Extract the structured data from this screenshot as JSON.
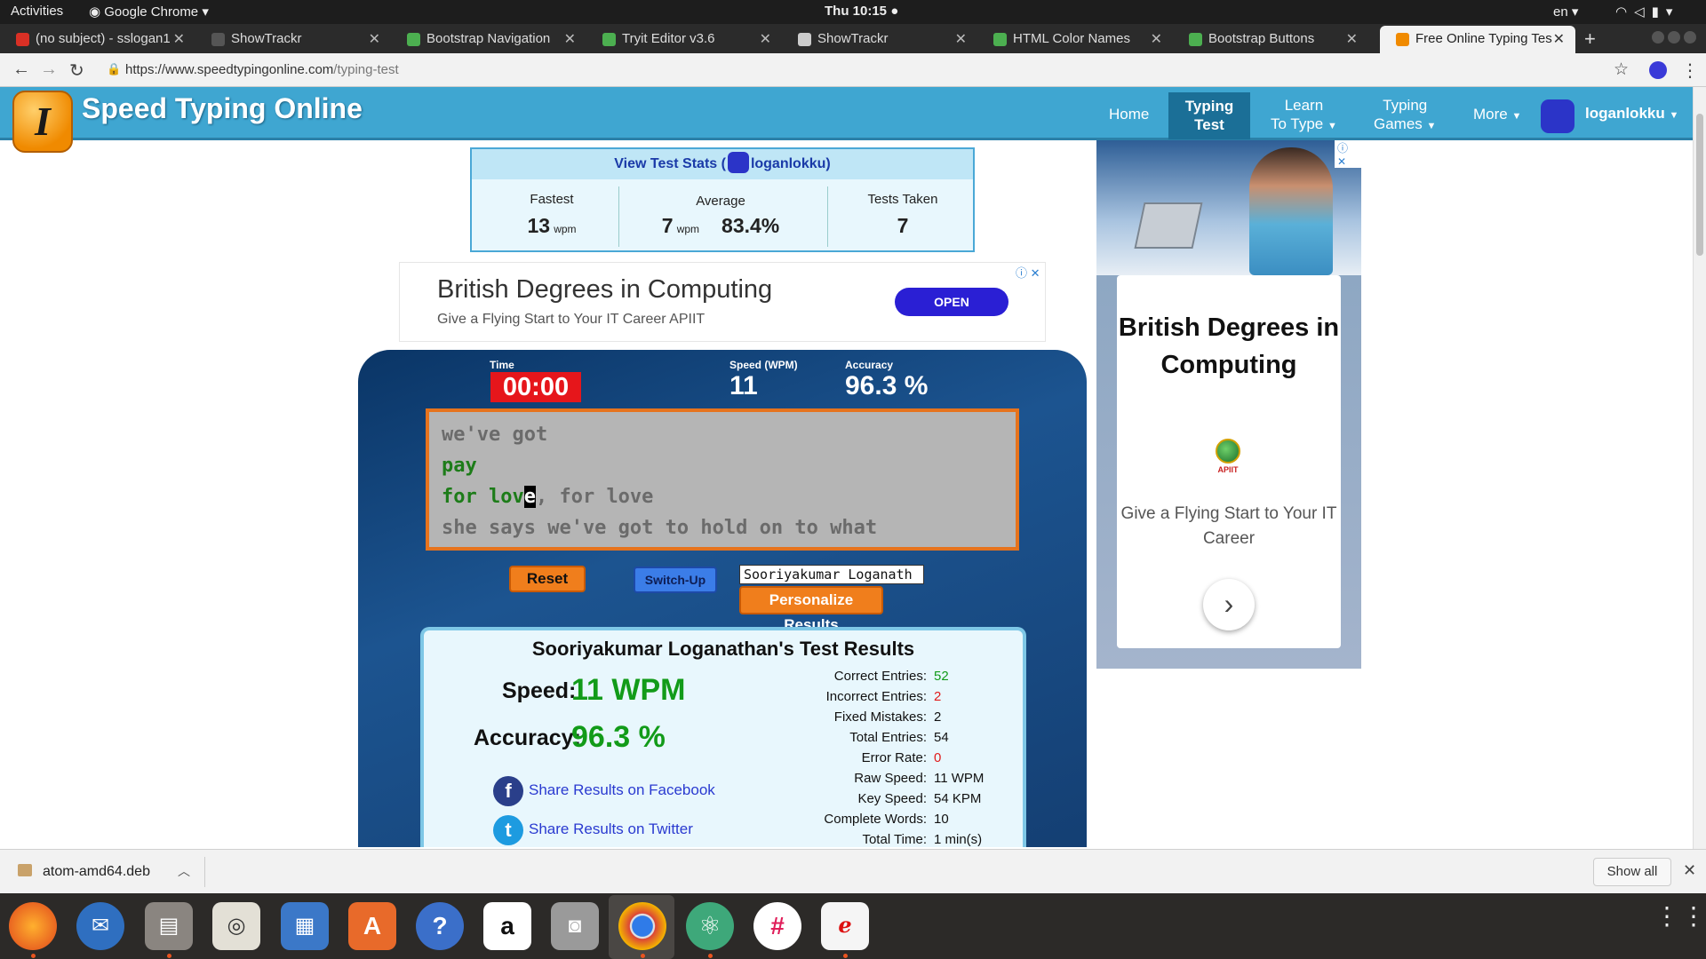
{
  "os": {
    "activities": "Activities",
    "app_menu": "Google Chrome",
    "clock": "Thu 10:15",
    "lang": "en"
  },
  "browser": {
    "tabs": [
      {
        "label": "(no subject) - sslogan1",
        "favicon_color": "#d93025"
      },
      {
        "label": "ShowTrackr",
        "favicon_color": "#555555"
      },
      {
        "label": "Bootstrap Navigation",
        "favicon_color": "#4caf50"
      },
      {
        "label": "Tryit Editor v3.6",
        "favicon_color": "#4caf50"
      },
      {
        "label": "ShowTrackr",
        "favicon_color": "#cccccc"
      },
      {
        "label": "HTML Color Names",
        "favicon_color": "#4caf50"
      },
      {
        "label": "Bootstrap Buttons",
        "favicon_color": "#4caf50"
      },
      {
        "label": "Free Online Typing Tes",
        "favicon_color": "#f08a00"
      }
    ],
    "url_prefix": "https://www.speedtypingonline.com",
    "url_path": "/typing-test"
  },
  "site": {
    "logo_letter": "I",
    "logo_text": "Speed Typing Online",
    "nav": {
      "home": "Home",
      "typing_test_1": "Typing",
      "typing_test_2": "Test",
      "learn_1": "Learn",
      "learn_2": "To Type",
      "games_1": "Typing",
      "games_2": "Games",
      "more": "More",
      "user": "loganlokku"
    },
    "accent": "#3fa6d1"
  },
  "stats": {
    "header_prefix": "View Test Stats (",
    "header_user": "loganlokku",
    "header_suffix": ")",
    "fastest_label": "Fastest",
    "fastest_value": "13",
    "average_label": "Average",
    "average_wpm": "7",
    "average_acc": "83.4%",
    "tests_label": "Tests Taken",
    "tests_value": "7",
    "unit": "wpm"
  },
  "ad_banner": {
    "title": "British Degrees in Computing",
    "subtitle": "Give a Flying Start to Your IT Career APIIT",
    "button": "OPEN"
  },
  "typing": {
    "time_label": "Time",
    "time_value": "00:00",
    "speed_label": "Speed (WPM)",
    "speed_value": "11",
    "accuracy_label": "Accuracy",
    "accuracy_value": "96.3 %",
    "line1": "we've got",
    "line2": "pay",
    "line3_ok": "for lov",
    "line3_cur": "e",
    "line3_rest": ", for love",
    "line4": "she says we've got to hold on to what",
    "reset": "Reset",
    "switch_up": "Switch-Up",
    "name_value": "Sooriyakumar Loganath",
    "personalize": "Personalize Results"
  },
  "results": {
    "title": "Sooriyakumar Loganathan's Test Results",
    "speed_label": "Speed:",
    "speed_value": "11 WPM",
    "accuracy_label": "Accuracy:",
    "accuracy_value": "96.3 %",
    "share_fb": "Share Results on Facebook",
    "share_tw": "Share Results on Twitter",
    "details": [
      {
        "label": "Correct Entries:",
        "value": "52",
        "color": "#129b19"
      },
      {
        "label": "Incorrect Entries:",
        "value": "2",
        "color": "#e01b1b"
      },
      {
        "label": "Fixed Mistakes:",
        "value": "2",
        "color": "#111111"
      },
      {
        "label": "Total Entries:",
        "value": "54",
        "color": "#111111"
      },
      {
        "label": "Error Rate:",
        "value": "0",
        "color": "#e01b1b"
      },
      {
        "label": "Raw Speed:",
        "value": "11 WPM",
        "color": "#111111"
      },
      {
        "label": "Key Speed:",
        "value": "54 KPM",
        "color": "#111111"
      },
      {
        "label": "Complete Words:",
        "value": "10",
        "color": "#111111"
      },
      {
        "label": "Total Time:",
        "value": "1 min(s)",
        "color": "#111111"
      }
    ]
  },
  "side_ad": {
    "title": "British Degrees in Computing",
    "logo_text": "APIIT",
    "subtitle": "Give a Flying Start to Your IT Career"
  },
  "download": {
    "file": "atom-amd64.deb",
    "show_all": "Show all"
  }
}
